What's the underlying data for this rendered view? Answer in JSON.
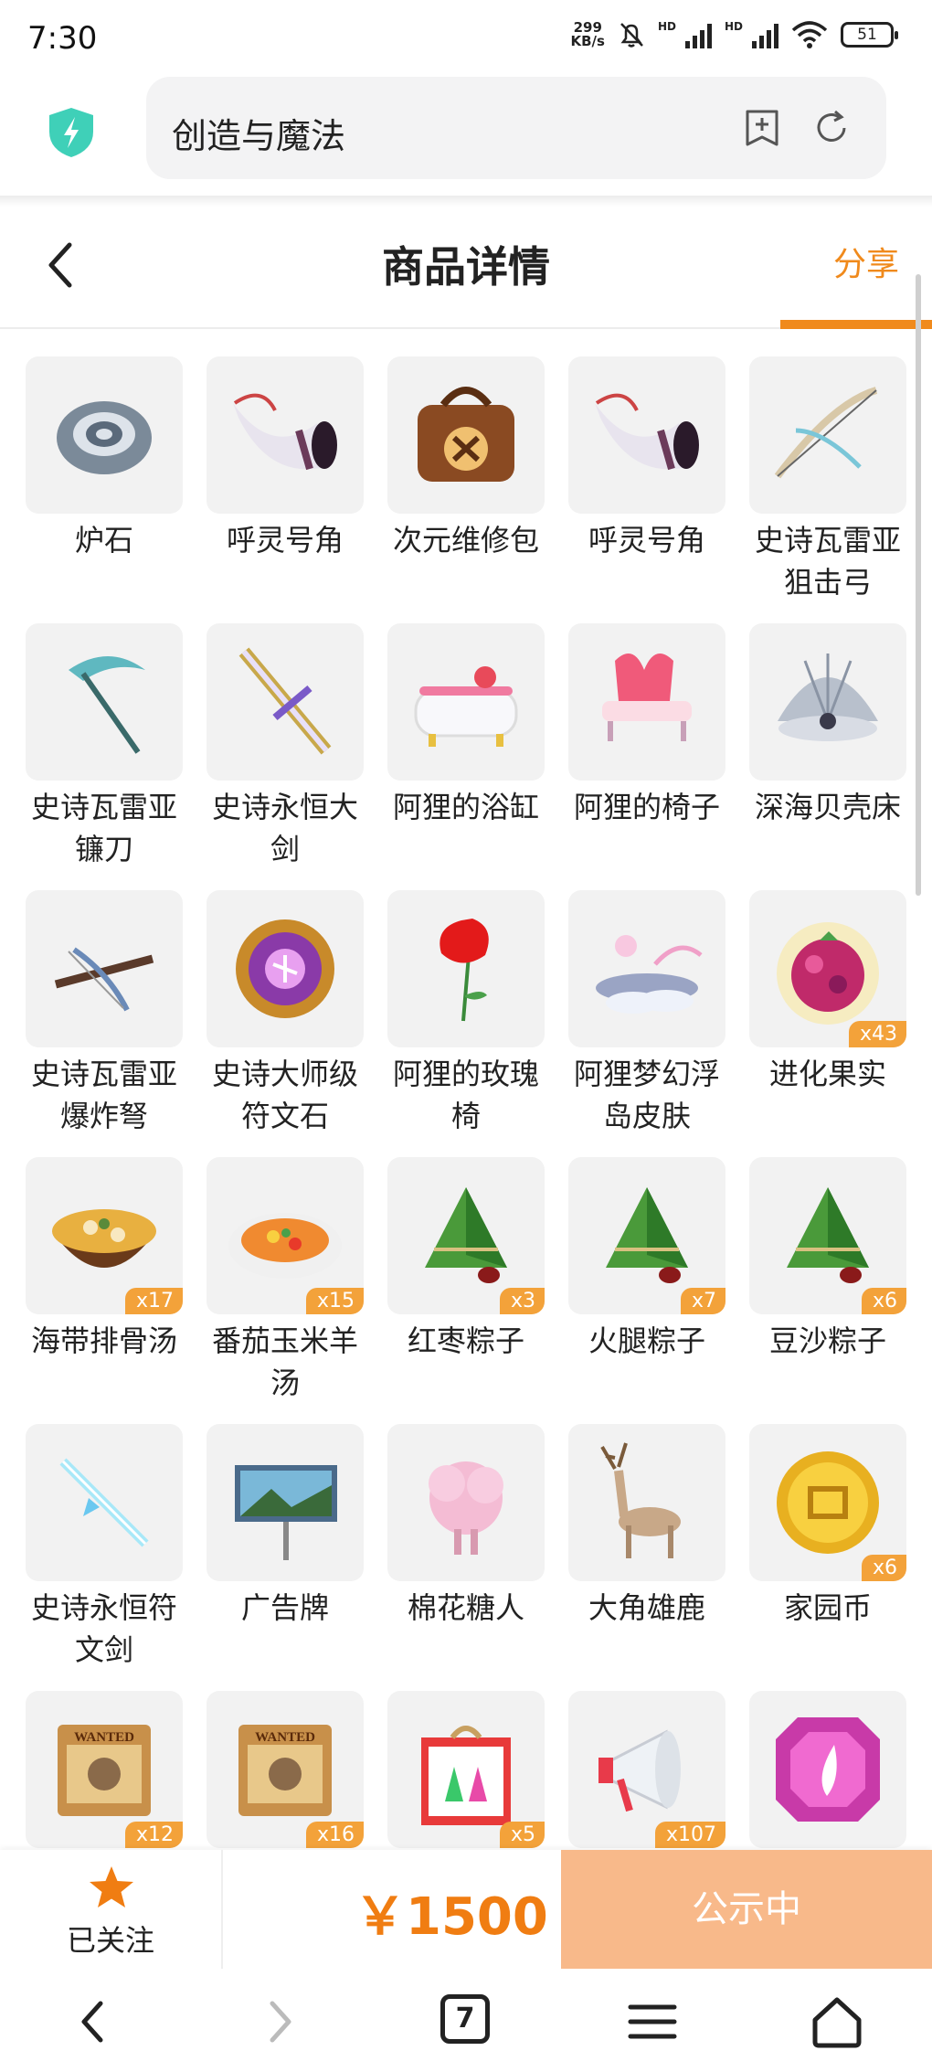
{
  "status_bar": {
    "time": "7:30",
    "net_speed_value": "299",
    "net_speed_unit": "KB/s",
    "hd1": "HD",
    "hd2": "HD",
    "battery": "51"
  },
  "browser": {
    "url_text": "创造与魔法",
    "icons": [
      "shield-lightning-icon",
      "bookmark-add-icon",
      "refresh-icon"
    ]
  },
  "header": {
    "title": "商品详情",
    "share_label": "分享"
  },
  "items": [
    {
      "name": "炉石",
      "qty": "",
      "icon": "hearthstone"
    },
    {
      "name": "呼灵号角",
      "qty": "",
      "icon": "horn"
    },
    {
      "name": "次元维修包",
      "qty": "",
      "icon": "repair-bag"
    },
    {
      "name": "呼灵号角",
      "qty": "",
      "icon": "horn"
    },
    {
      "name": "史诗瓦雷亚狙击弓",
      "qty": "",
      "icon": "bow"
    },
    {
      "name": "史诗瓦雷亚镰刀",
      "qty": "",
      "icon": "scythe"
    },
    {
      "name": "史诗永恒大剑",
      "qty": "",
      "icon": "sword"
    },
    {
      "name": "阿狸的浴缸",
      "qty": "",
      "icon": "bathtub"
    },
    {
      "name": "阿狸的椅子",
      "qty": "",
      "icon": "chair"
    },
    {
      "name": "深海贝壳床",
      "qty": "",
      "icon": "shell"
    },
    {
      "name": "史诗瓦雷亚爆炸弩",
      "qty": "",
      "icon": "crossbow"
    },
    {
      "name": "史诗大师级符文石",
      "qty": "",
      "icon": "rune-stone"
    },
    {
      "name": "阿狸的玫瑰椅",
      "qty": "",
      "icon": "rose"
    },
    {
      "name": "阿狸梦幻浮岛皮肤",
      "qty": "",
      "icon": "island"
    },
    {
      "name": "进化果实",
      "qty": "x43",
      "icon": "berry"
    },
    {
      "name": "海带排骨汤",
      "qty": "x17",
      "icon": "soup"
    },
    {
      "name": "番茄玉米羊汤",
      "qty": "x15",
      "icon": "soup2"
    },
    {
      "name": "红枣粽子",
      "qty": "x3",
      "icon": "zongzi"
    },
    {
      "name": "火腿粽子",
      "qty": "x7",
      "icon": "zongzi"
    },
    {
      "name": "豆沙粽子",
      "qty": "x6",
      "icon": "zongzi"
    },
    {
      "name": "史诗永恒符文剑",
      "qty": "",
      "icon": "crystal-sword"
    },
    {
      "name": "广告牌",
      "qty": "",
      "icon": "billboard"
    },
    {
      "name": "棉花糖人",
      "qty": "",
      "icon": "cotton"
    },
    {
      "name": "大角雄鹿",
      "qty": "",
      "icon": "deer"
    },
    {
      "name": "家园币",
      "qty": "x6",
      "icon": "coin"
    },
    {
      "name": "",
      "qty": "x12",
      "icon": "wanted",
      "wanted_label": "WANTED"
    },
    {
      "name": "",
      "qty": "x16",
      "icon": "wanted",
      "wanted_label": "WANTED"
    },
    {
      "name": "",
      "qty": "x5",
      "icon": "gift"
    },
    {
      "name": "",
      "qty": "x107",
      "icon": "megaphone"
    },
    {
      "name": "",
      "qty": "",
      "icon": "gem"
    }
  ],
  "action_bar": {
    "follow_label": "已关注",
    "price": "￥1500",
    "status_label": "公示中"
  },
  "nav_bar": {
    "tab_count": "7"
  },
  "colors": {
    "accent": "#f08a1c",
    "price": "#f07d12",
    "status_button": "#f8b98a",
    "qty_badge": "#f3a23a"
  }
}
